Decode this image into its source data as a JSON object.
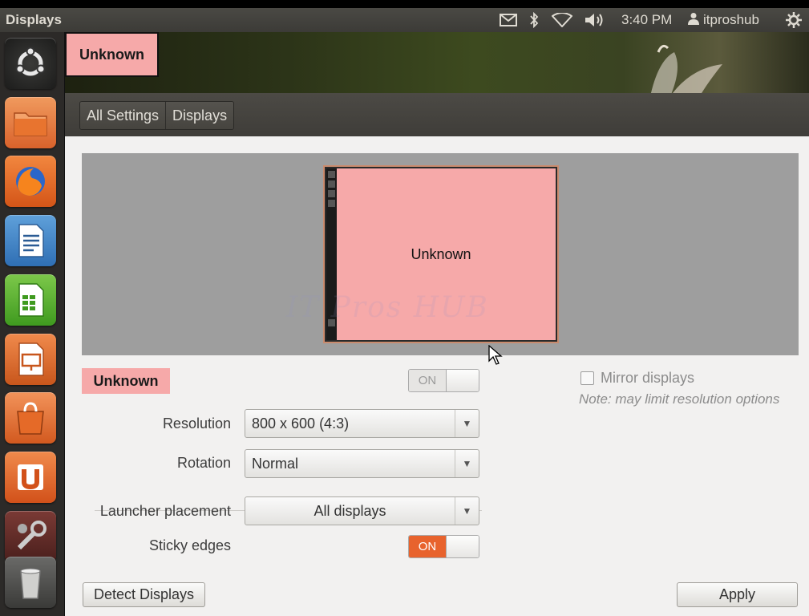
{
  "panel": {
    "window_title": "Displays",
    "clock": "3:40 PM",
    "username": "itproshub",
    "icons": [
      "mail-icon",
      "bluetooth-icon",
      "wifi-icon",
      "volume-icon",
      "user-icon",
      "gear-icon"
    ]
  },
  "launcher": {
    "items": [
      "dash-icon",
      "files-icon",
      "firefox-icon",
      "writer-icon",
      "calc-icon",
      "impress-icon",
      "software-center-icon",
      "ubuntu-one-icon",
      "system-settings-icon",
      "trash-icon"
    ]
  },
  "header": {
    "tag_label": "Unknown"
  },
  "breadcrumb": {
    "items": [
      "All Settings",
      "Displays"
    ]
  },
  "preview": {
    "monitor_label": "Unknown",
    "watermark": "IT Pros HUB"
  },
  "display": {
    "name": "Unknown",
    "power_switch": "ON",
    "resolution_label": "Resolution",
    "resolution_value": "800 x 600 (4:3)",
    "rotation_label": "Rotation",
    "rotation_value": "Normal",
    "launcher_placement_label": "Launcher placement",
    "launcher_placement_value": "All displays",
    "sticky_edges_label": "Sticky edges",
    "sticky_edges_value": "ON",
    "mirror_label": "Mirror displays",
    "mirror_note": "Note: may limit resolution options"
  },
  "actions": {
    "detect": "Detect Displays",
    "apply": "Apply"
  },
  "colors": {
    "monitor_fill": "#f6a9a9",
    "switch_on": "#e8632d",
    "panel": "#3c3b37"
  }
}
